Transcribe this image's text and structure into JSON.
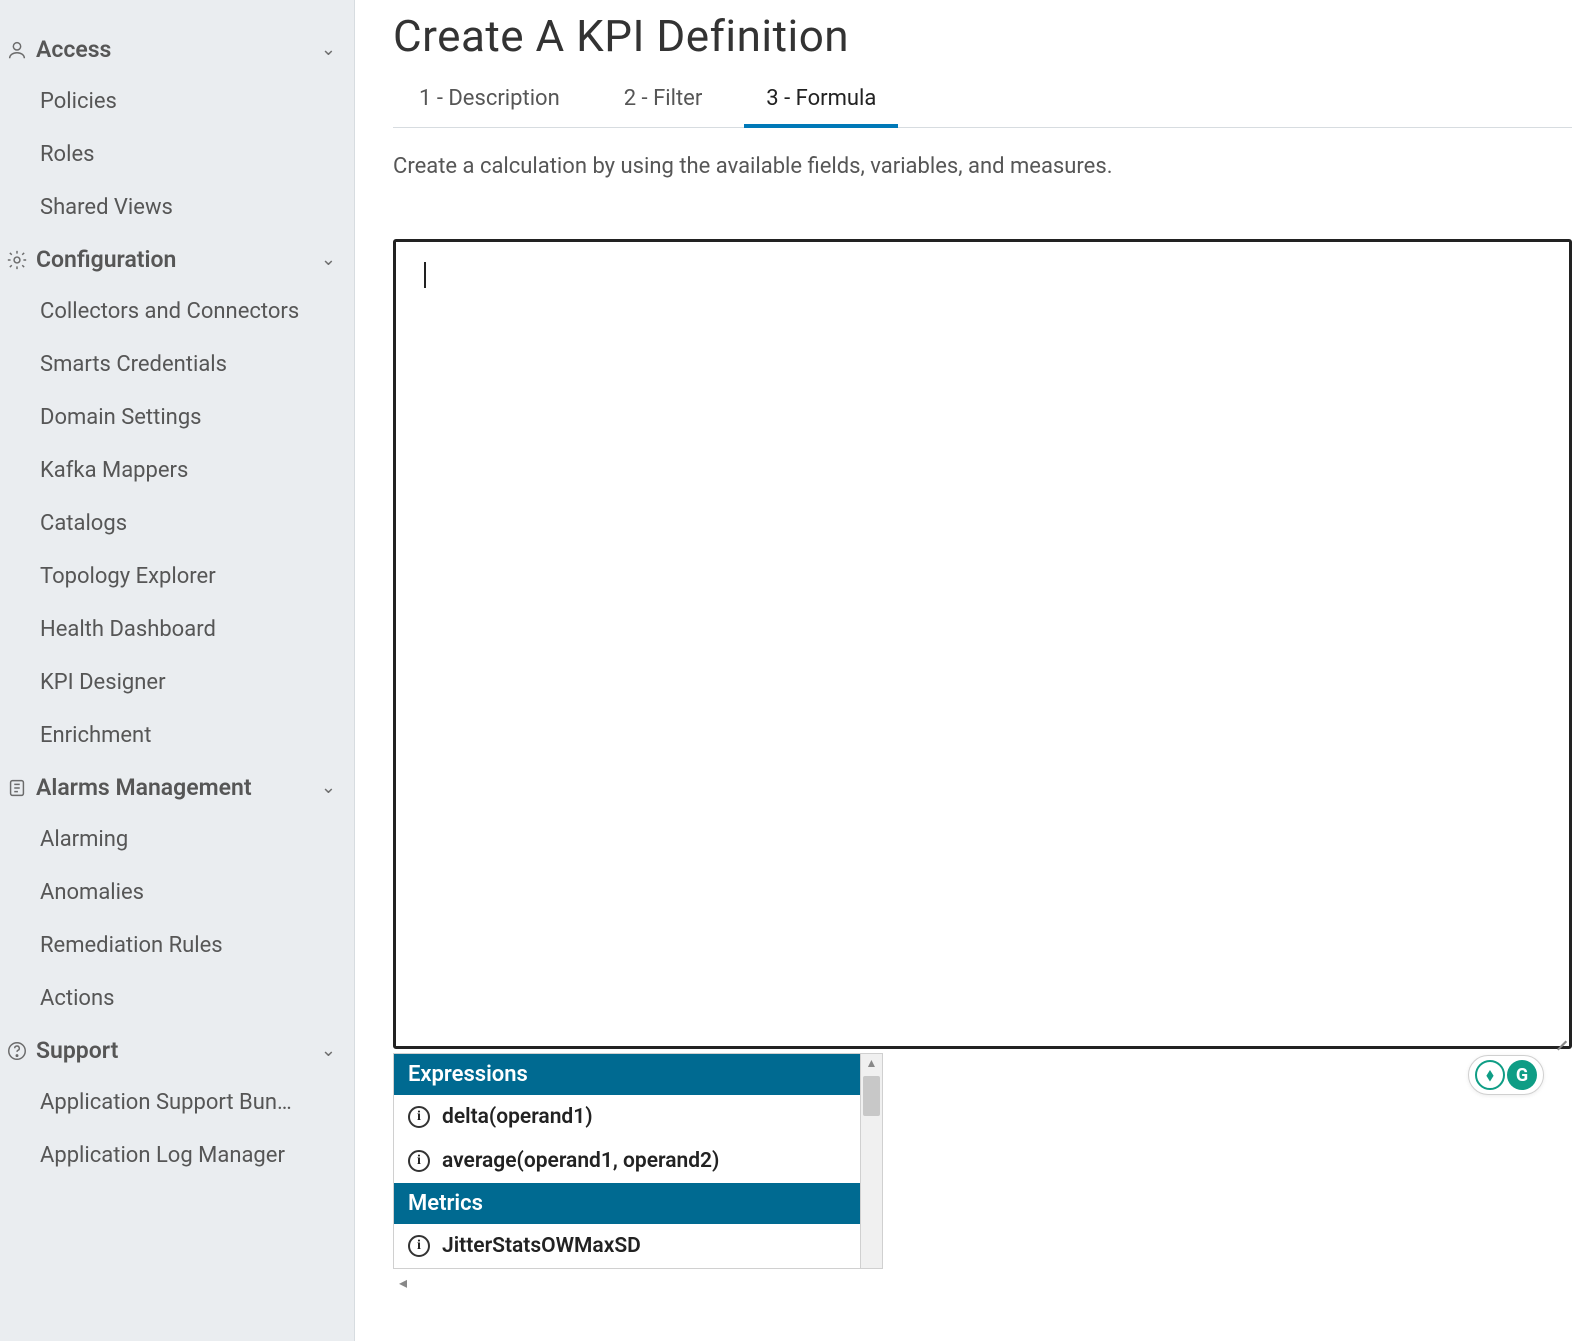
{
  "page": {
    "title": "Create A KPI Definition",
    "instruction": "Create a calculation by using the available fields, variables, and measures."
  },
  "tabs": [
    {
      "label": "1 - Description",
      "active": false
    },
    {
      "label": "2 - Filter",
      "active": false
    },
    {
      "label": "3 - Formula",
      "active": true
    }
  ],
  "formula": {
    "value": ""
  },
  "suggest": {
    "groups": [
      {
        "title": "Expressions",
        "items": [
          {
            "label": "delta(operand1)"
          },
          {
            "label": "average(operand1, operand2)"
          }
        ]
      },
      {
        "title": "Metrics",
        "items": [
          {
            "label": "JitterStatsOWMaxSD"
          }
        ]
      }
    ]
  },
  "sidebar": {
    "sections": [
      {
        "icon": "user-icon",
        "label": "Access",
        "items": [
          {
            "label": "Policies"
          },
          {
            "label": "Roles"
          },
          {
            "label": "Shared Views"
          }
        ]
      },
      {
        "icon": "gear-icon",
        "label": "Configuration",
        "items": [
          {
            "label": "Collectors and Connectors"
          },
          {
            "label": "Smarts Credentials"
          },
          {
            "label": "Domain Settings"
          },
          {
            "label": "Kafka Mappers"
          },
          {
            "label": "Catalogs"
          },
          {
            "label": "Topology Explorer"
          },
          {
            "label": "Health Dashboard"
          },
          {
            "label": "KPI Designer"
          },
          {
            "label": "Enrichment"
          }
        ]
      },
      {
        "icon": "alarm-icon",
        "label": "Alarms Management",
        "items": [
          {
            "label": "Alarming"
          },
          {
            "label": "Anomalies"
          },
          {
            "label": "Remediation Rules"
          },
          {
            "label": "Actions"
          }
        ]
      },
      {
        "icon": "help-icon",
        "label": "Support",
        "items": [
          {
            "label": "Application Support Bun…"
          },
          {
            "label": "Application Log Manager"
          }
        ]
      }
    ]
  }
}
